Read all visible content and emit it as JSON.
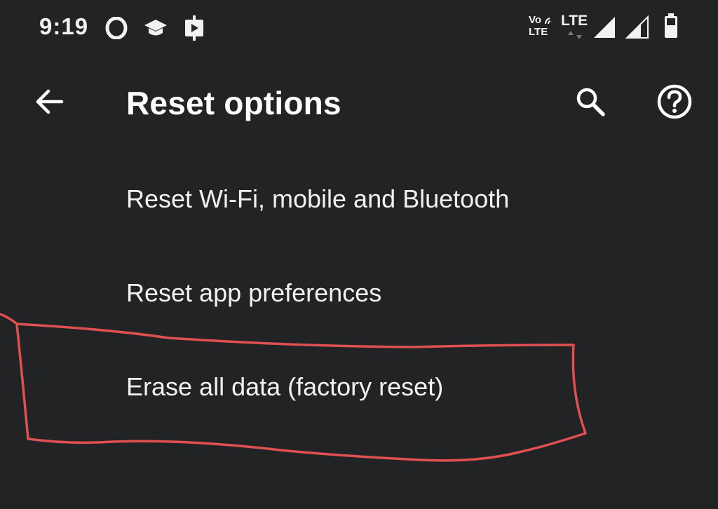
{
  "status_bar": {
    "time": "9:19",
    "left_icons": [
      "opera-icon",
      "graduation-cap-icon",
      "screen-record-icon"
    ],
    "volte_top": "Vo",
    "volte_bottom": "LTE",
    "network_type": "LTE",
    "right_icons": [
      "volte-icon",
      "lte-icon",
      "signal-full-icon",
      "signal-partial-icon",
      "battery-icon"
    ]
  },
  "app_bar": {
    "title": "Reset options",
    "back_icon": "arrow-left-icon",
    "search_icon": "search-icon",
    "help_icon": "help-icon"
  },
  "reset_list": {
    "items": [
      {
        "label": "Reset Wi-Fi, mobile and Bluetooth"
      },
      {
        "label": "Reset app preferences"
      },
      {
        "label": "Erase all data (factory reset)"
      }
    ]
  },
  "annotation": {
    "color": "#e05050",
    "target": "Erase all data (factory reset)"
  }
}
